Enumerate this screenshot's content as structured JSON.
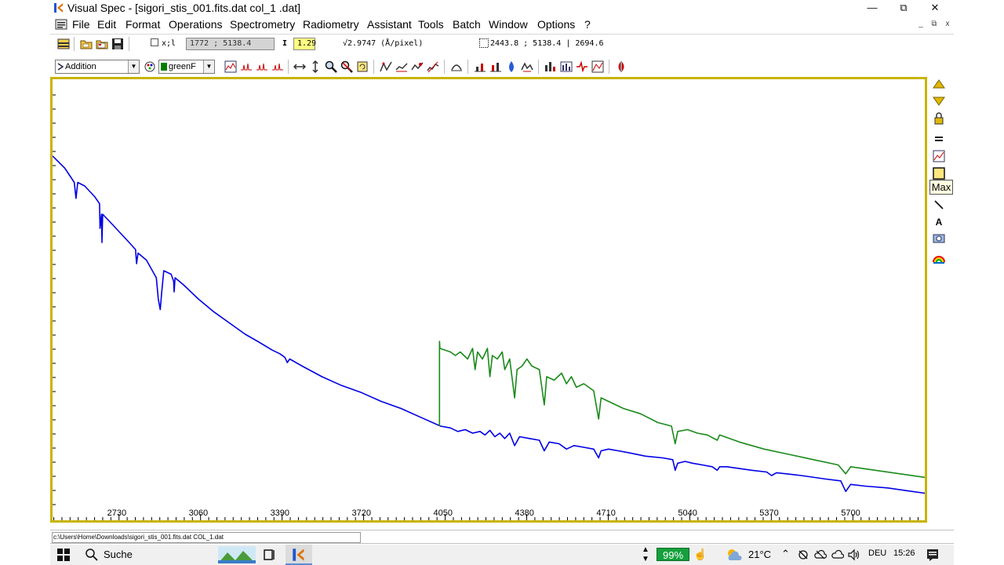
{
  "window": {
    "title": "Visual Spec - [sigori_stis_001.fits.dat col_1 .dat]",
    "minimize_label": "—",
    "restore_label": "⧉",
    "close_label": "✕"
  },
  "menu": {
    "items": [
      "File",
      "Edit",
      "Format",
      "Operations",
      "Spectrometry",
      "Radiometry",
      "Assistant",
      "Tools",
      "Batch",
      "Window",
      "Options",
      "?"
    ],
    "mdi_minimize": "_",
    "mdi_restore": "⧉",
    "mdi_close": "x"
  },
  "toolbar1": {
    "xy_label": "x;l",
    "cursor_value": "1772 ; 5138.4",
    "intensity_label": "I",
    "intensity_value": "1.29",
    "dispersion": "√2.9747 (Å/pixel)",
    "selection": "2443.8 ; 5138.4 |   2694.6"
  },
  "toolbar2": {
    "operation": "Addition",
    "color": "greenF",
    "color_swatch": "#008000"
  },
  "chart_data": {
    "type": "line",
    "xlim": [
      2470,
      6000
    ],
    "ylim": [
      0,
      1
    ],
    "x_ticks": [
      2730,
      3060,
      3390,
      3720,
      4050,
      4380,
      4710,
      5040,
      5370,
      5700
    ],
    "grid": false,
    "series": [
      {
        "color": "#0000e6",
        "points": [
          [
            2470,
            0.905
          ],
          [
            2520,
            0.87
          ],
          [
            2558,
            0.83
          ],
          [
            2565,
            0.785
          ],
          [
            2572,
            0.83
          ],
          [
            2600,
            0.82
          ],
          [
            2640,
            0.79
          ],
          [
            2660,
            0.77
          ],
          [
            2662,
            0.7
          ],
          [
            2668,
            0.74
          ],
          [
            2670,
            0.66
          ],
          [
            2673,
            0.74
          ],
          [
            2700,
            0.72
          ],
          [
            2740,
            0.69
          ],
          [
            2780,
            0.66
          ],
          [
            2806,
            0.64
          ],
          [
            2810,
            0.6
          ],
          [
            2816,
            0.63
          ],
          [
            2850,
            0.61
          ],
          [
            2890,
            0.56
          ],
          [
            2898,
            0.5
          ],
          [
            2906,
            0.47
          ],
          [
            2912,
            0.52
          ],
          [
            2920,
            0.58
          ],
          [
            2950,
            0.57
          ],
          [
            2960,
            0.55
          ],
          [
            2962,
            0.52
          ],
          [
            2966,
            0.56
          ],
          [
            3000,
            0.54
          ],
          [
            3060,
            0.5
          ],
          [
            3120,
            0.465
          ],
          [
            3190,
            0.43
          ],
          [
            3250,
            0.4
          ],
          [
            3300,
            0.38
          ],
          [
            3360,
            0.355
          ],
          [
            3390,
            0.345
          ],
          [
            3410,
            0.335
          ],
          [
            3420,
            0.32
          ],
          [
            3430,
            0.33
          ],
          [
            3480,
            0.31
          ],
          [
            3560,
            0.28
          ],
          [
            3640,
            0.255
          ],
          [
            3720,
            0.235
          ],
          [
            3800,
            0.21
          ],
          [
            3880,
            0.19
          ],
          [
            3960,
            0.165
          ],
          [
            4040,
            0.14
          ],
          [
            4080,
            0.135
          ],
          [
            4110,
            0.125
          ],
          [
            4140,
            0.13
          ],
          [
            4170,
            0.12
          ],
          [
            4200,
            0.125
          ],
          [
            4220,
            0.115
          ],
          [
            4240,
            0.128
          ],
          [
            4260,
            0.11
          ],
          [
            4280,
            0.12
          ],
          [
            4300,
            0.105
          ],
          [
            4320,
            0.12
          ],
          [
            4340,
            0.085
          ],
          [
            4360,
            0.11
          ],
          [
            4400,
            0.105
          ],
          [
            4440,
            0.1
          ],
          [
            4460,
            0.07
          ],
          [
            4480,
            0.095
          ],
          [
            4520,
            0.09
          ],
          [
            4550,
            0.075
          ],
          [
            4580,
            0.085
          ],
          [
            4620,
            0.08
          ],
          [
            4660,
            0.075
          ],
          [
            4680,
            0.05
          ],
          [
            4690,
            0.07
          ],
          [
            4720,
            0.075
          ],
          [
            4760,
            0.07
          ],
          [
            4800,
            0.065
          ],
          [
            4870,
            0.055
          ],
          [
            4940,
            0.05
          ],
          [
            4980,
            0.045
          ],
          [
            4990,
            0.015
          ],
          [
            5000,
            0.035
          ],
          [
            5030,
            0.04
          ],
          [
            5060,
            0.035
          ],
          [
            5100,
            0.03
          ],
          [
            5140,
            0.025
          ],
          [
            5160,
            0.015
          ],
          [
            5170,
            0.025
          ],
          [
            5200,
            0.025
          ],
          [
            5300,
            0.015
          ],
          [
            5360,
            0.01
          ],
          [
            5380,
            0.0
          ],
          [
            5400,
            0.008
          ],
          [
            5500,
            0.0
          ],
          [
            5600,
            -0.01
          ],
          [
            5660,
            -0.015
          ],
          [
            5680,
            -0.045
          ],
          [
            5700,
            -0.025
          ],
          [
            5760,
            -0.03
          ],
          [
            5850,
            -0.035
          ],
          [
            5950,
            -0.045
          ],
          [
            6000,
            -0.05
          ]
        ]
      },
      {
        "color": "#1a8a1a",
        "points": [
          [
            4036,
            0.14
          ],
          [
            4036,
            0.38
          ],
          [
            4038,
            0.36
          ],
          [
            4080,
            0.35
          ],
          [
            4100,
            0.34
          ],
          [
            4120,
            0.35
          ],
          [
            4150,
            0.33
          ],
          [
            4170,
            0.36
          ],
          [
            4180,
            0.3
          ],
          [
            4190,
            0.35
          ],
          [
            4210,
            0.33
          ],
          [
            4230,
            0.36
          ],
          [
            4240,
            0.28
          ],
          [
            4250,
            0.34
          ],
          [
            4270,
            0.33
          ],
          [
            4290,
            0.35
          ],
          [
            4300,
            0.3
          ],
          [
            4320,
            0.33
          ],
          [
            4340,
            0.22
          ],
          [
            4350,
            0.3
          ],
          [
            4370,
            0.31
          ],
          [
            4390,
            0.33
          ],
          [
            4410,
            0.31
          ],
          [
            4440,
            0.3
          ],
          [
            4460,
            0.2
          ],
          [
            4470,
            0.28
          ],
          [
            4500,
            0.27
          ],
          [
            4530,
            0.29
          ],
          [
            4550,
            0.26
          ],
          [
            4570,
            0.28
          ],
          [
            4590,
            0.25
          ],
          [
            4620,
            0.26
          ],
          [
            4660,
            0.24
          ],
          [
            4680,
            0.16
          ],
          [
            4690,
            0.22
          ],
          [
            4720,
            0.21
          ],
          [
            4780,
            0.19
          ],
          [
            4850,
            0.175
          ],
          [
            4920,
            0.15
          ],
          [
            4975,
            0.14
          ],
          [
            4990,
            0.09
          ],
          [
            5000,
            0.125
          ],
          [
            5040,
            0.13
          ],
          [
            5080,
            0.12
          ],
          [
            5120,
            0.115
          ],
          [
            5160,
            0.1
          ],
          [
            5170,
            0.115
          ],
          [
            5250,
            0.095
          ],
          [
            5350,
            0.075
          ],
          [
            5450,
            0.06
          ],
          [
            5550,
            0.045
          ],
          [
            5650,
            0.03
          ],
          [
            5680,
            0.005
          ],
          [
            5700,
            0.025
          ],
          [
            5800,
            0.015
          ],
          [
            5900,
            0.005
          ],
          [
            6000,
            -0.005
          ]
        ]
      }
    ]
  },
  "vtoolbar": {
    "tooltip": "Max",
    "icons": [
      "arrow-up-icon",
      "arrow-down-icon",
      "lock-icon",
      "equals-icon",
      "chart-icon",
      "max-icon",
      "line-tool-icon",
      "text-tool-icon",
      "camera-icon",
      "rainbow-icon"
    ],
    "text_tool_label": "A"
  },
  "status": {
    "path": "c:\\Users\\Home\\Downloads\\sigori_stis_001.fits.dat COL_1.dat"
  },
  "taskbar": {
    "search_label": "Suche",
    "battery": "99%",
    "temperature": "21°C",
    "language": "DEU",
    "time": "15:26"
  }
}
